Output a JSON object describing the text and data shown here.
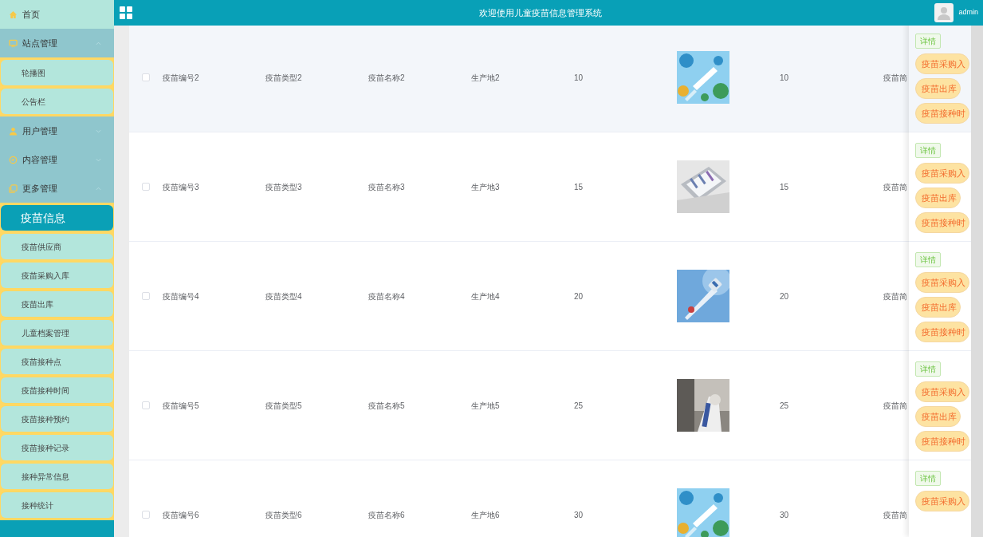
{
  "header": {
    "title": "欢迎使用儿童疫苗信息管理系统",
    "user": "admin"
  },
  "sidebar": {
    "items": [
      {
        "kind": "home",
        "label": "首页",
        "selected": true
      },
      {
        "kind": "monitor",
        "label": "站点管理",
        "selected": false,
        "expanded": true,
        "children": [
          {
            "label": "轮播图",
            "selected": false
          },
          {
            "label": "公告栏",
            "selected": false
          }
        ]
      },
      {
        "kind": "user",
        "label": "用户管理",
        "selected": false,
        "expanded": false
      },
      {
        "kind": "chat",
        "label": "内容管理",
        "selected": false,
        "expanded": false
      },
      {
        "kind": "copy",
        "label": "更多管理",
        "selected": false,
        "expanded": true,
        "children": [
          {
            "label": "疫苗信息",
            "selected": true
          },
          {
            "label": "疫苗供应商",
            "selected": false
          },
          {
            "label": "疫苗采购入库",
            "selected": false
          },
          {
            "label": "疫苗出库",
            "selected": false
          },
          {
            "label": "儿童档案管理",
            "selected": false
          },
          {
            "label": "疫苗接种点",
            "selected": false
          },
          {
            "label": "疫苗接种时间",
            "selected": false
          },
          {
            "label": "疫苗接种预约",
            "selected": false
          },
          {
            "label": "疫苗接种记录",
            "selected": false
          },
          {
            "label": "接种异常信息",
            "selected": false
          },
          {
            "label": "接种统计",
            "selected": false
          }
        ]
      }
    ]
  },
  "table": {
    "rows": [
      {
        "checked": false,
        "hovered": true,
        "code": "疫苗编号2",
        "type": "疫苗类型2",
        "name": "疫苗名称2",
        "origin": "生产地2",
        "column_5": "10",
        "picture": {
          "kind": "picture"
        },
        "column_7": "10",
        "column_8": "疫苗简",
        "actions": [
          {
            "kind": "detail",
            "label": "详情"
          },
          {
            "kind": "pill",
            "label": "疫苗采购入"
          },
          {
            "kind": "pill",
            "label": "疫苗出库"
          },
          {
            "kind": "pill",
            "label": "疫苗接种时"
          }
        ]
      },
      {
        "checked": false,
        "hovered": false,
        "code": "疫苗编号3",
        "type": "疫苗类型3",
        "name": "疫苗名称3",
        "origin": "生产地3",
        "column_5": "15",
        "picture": {
          "kind": "picture"
        },
        "column_7": "15",
        "column_8": "疫苗简",
        "actions": [
          {
            "kind": "detail",
            "label": "详情"
          },
          {
            "kind": "pill",
            "label": "疫苗采购入"
          },
          {
            "kind": "pill",
            "label": "疫苗出库"
          },
          {
            "kind": "pill",
            "label": "疫苗接种时"
          }
        ]
      },
      {
        "checked": false,
        "hovered": false,
        "code": "疫苗编号4",
        "type": "疫苗类型4",
        "name": "疫苗名称4",
        "origin": "生产地4",
        "column_5": "20",
        "picture": {
          "kind": "picture"
        },
        "column_7": "20",
        "column_8": "疫苗简",
        "actions": [
          {
            "kind": "detail",
            "label": "详情"
          },
          {
            "kind": "pill",
            "label": "疫苗采购入"
          },
          {
            "kind": "pill",
            "label": "疫苗出库"
          },
          {
            "kind": "pill",
            "label": "疫苗接种时"
          }
        ]
      },
      {
        "checked": false,
        "hovered": false,
        "code": "疫苗编号5",
        "type": "疫苗类型5",
        "name": "疫苗名称5",
        "origin": "生产地5",
        "column_5": "25",
        "picture": {
          "kind": "picture"
        },
        "column_7": "25",
        "column_8": "疫苗简",
        "actions": [
          {
            "kind": "detail",
            "label": "详情"
          },
          {
            "kind": "pill",
            "label": "疫苗采购入"
          },
          {
            "kind": "pill",
            "label": "疫苗出库"
          },
          {
            "kind": "pill",
            "label": "疫苗接种时"
          }
        ]
      },
      {
        "checked": false,
        "hovered": false,
        "code": "疫苗编号6",
        "type": "疫苗类型6",
        "name": "疫苗名称6",
        "origin": "生产地6",
        "column_5": "30",
        "picture": {
          "kind": "picture"
        },
        "column_7": "30",
        "column_8": "疫苗简",
        "actions": [
          {
            "kind": "detail",
            "label": "详情"
          },
          {
            "kind": "pill",
            "label": "疫苗采购入"
          }
        ]
      }
    ]
  }
}
